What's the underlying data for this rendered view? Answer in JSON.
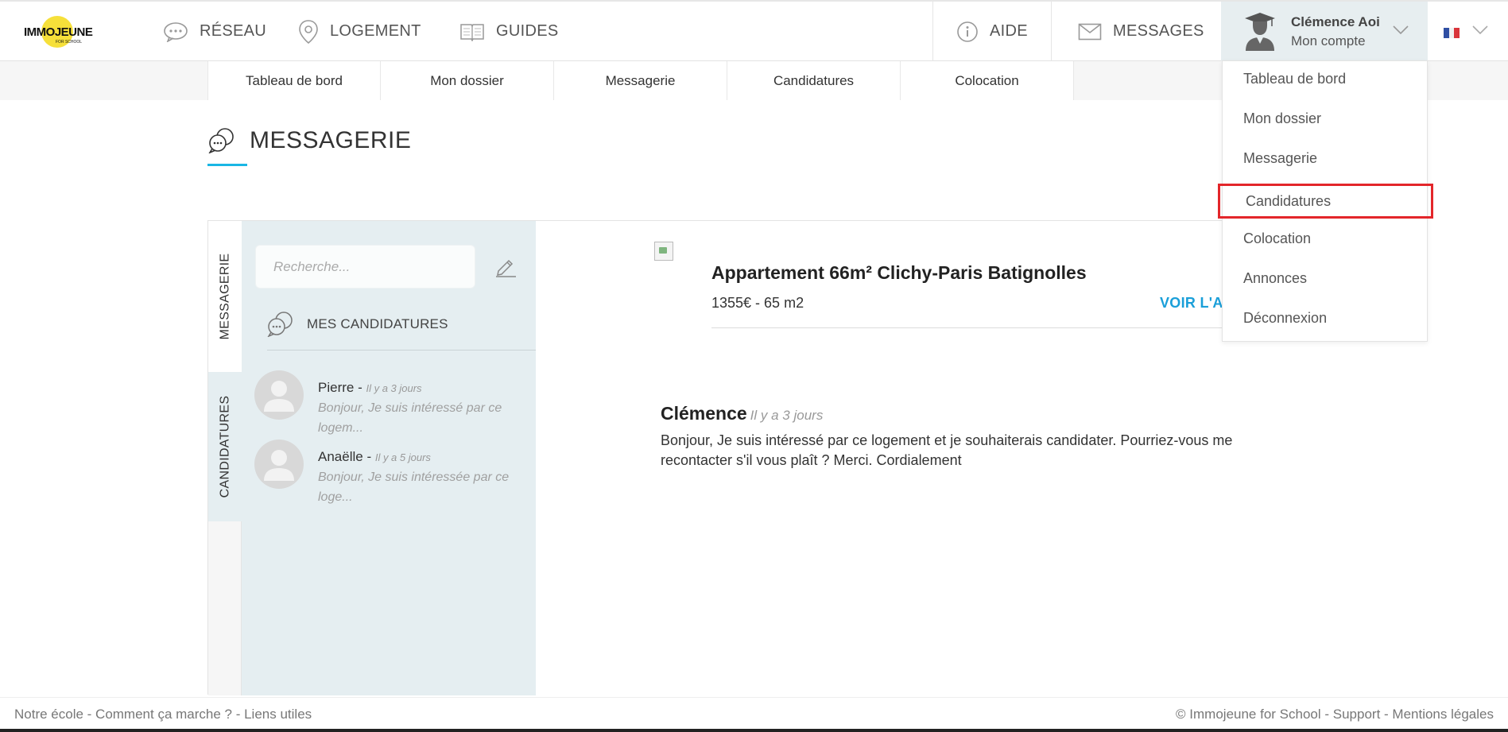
{
  "brand": {
    "logo_text": "IMMOJEUNE",
    "logo_sub": "FOR SCHOOL"
  },
  "nav": {
    "reseau": "RÉSEAU",
    "logement": "LOGEMENT",
    "guides": "GUIDES",
    "aide": "AIDE",
    "messages": "MESSAGES"
  },
  "account": {
    "name": "Clémence Aoi",
    "subtitle": "Mon compte"
  },
  "subnav": [
    "Tableau de bord",
    "Mon dossier",
    "Messagerie",
    "Candidatures",
    "Colocation"
  ],
  "page": {
    "title": "MESSAGERIE"
  },
  "side_tabs": {
    "messagerie": "MESSAGERIE",
    "candidatures": "CANDIDATURES"
  },
  "search": {
    "placeholder": "Recherche..."
  },
  "section_heading": "MES CANDIDATURES",
  "conversations": [
    {
      "name": "Pierre",
      "separator": " - ",
      "time": "Il y a 3 jours",
      "preview": "Bonjour, Je suis intéressé par ce logem..."
    },
    {
      "name": "Anaëlle",
      "separator": " - ",
      "time": "Il y a 5 jours",
      "preview": "Bonjour, Je suis intéressée par ce loge..."
    }
  ],
  "listing": {
    "title": "Appartement 66m² Clichy-Paris Batignolles",
    "meta": "1355€ - 65 m2",
    "link": "VOIR L'ANNONCE"
  },
  "message": {
    "author": "Clémence",
    "time": "Il y a 3 jours",
    "body": "Bonjour, Je suis intéressé par ce logement et je souhaiterais candidater. Pourriez-vous me recontacter s'il vous plaît ? Merci. Cordialement"
  },
  "dropdown": [
    "Tableau de bord",
    "Mon dossier",
    "Messagerie",
    "Candidatures",
    "Colocation",
    "Annonces",
    "Déconnexion"
  ],
  "footer": {
    "left": "Notre école - Comment ça marche ? - Liens utiles",
    "right": "© Immojeune for School - Support - Mentions légales"
  },
  "colors": {
    "accent": "#1ab6e4",
    "link": "#1a9fd9",
    "highlight": "#e3262a",
    "panel_bg": "#e5eef1",
    "logo_yellow": "#f6e03a"
  }
}
